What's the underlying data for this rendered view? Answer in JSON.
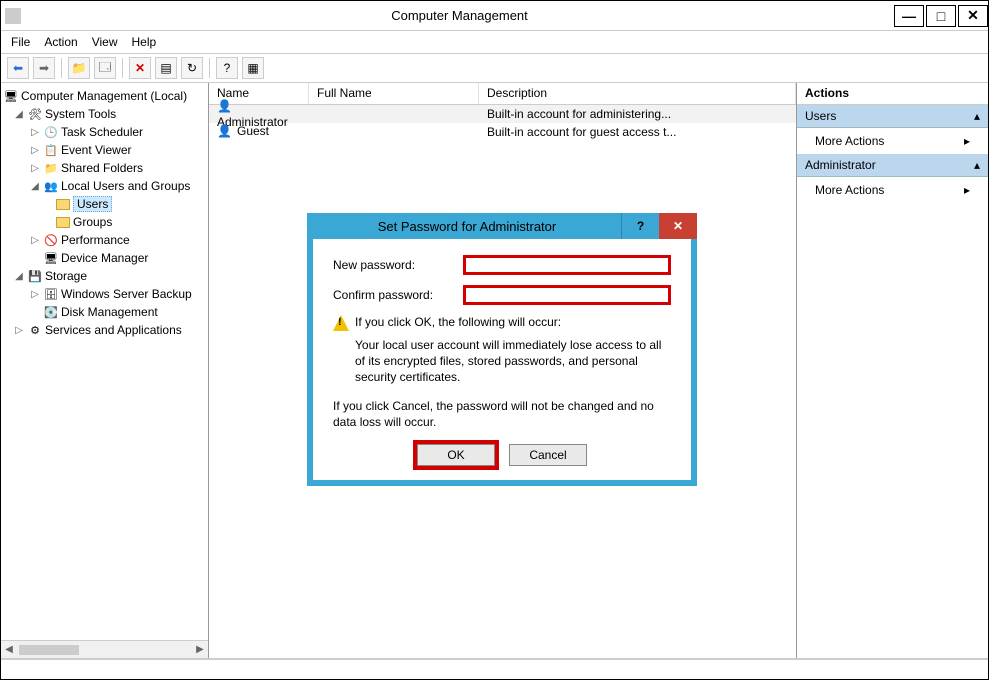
{
  "window": {
    "title": "Computer Management"
  },
  "menubar": {
    "file": "File",
    "action": "Action",
    "view": "View",
    "help": "Help"
  },
  "tree": {
    "root": "Computer Management (Local)",
    "system_tools": "System Tools",
    "task_scheduler": "Task Scheduler",
    "event_viewer": "Event Viewer",
    "shared_folders": "Shared Folders",
    "local_users": "Local Users and Groups",
    "users": "Users",
    "groups": "Groups",
    "performance": "Performance",
    "device_manager": "Device Manager",
    "storage": "Storage",
    "wsb": "Windows Server Backup",
    "disk_mgmt": "Disk Management",
    "services": "Services and Applications"
  },
  "list": {
    "headers": {
      "name": "Name",
      "full": "Full Name",
      "desc": "Description"
    },
    "rows": [
      {
        "name": "Administrator",
        "full": "",
        "desc": "Built-in account for administering..."
      },
      {
        "name": "Guest",
        "full": "",
        "desc": "Built-in account for guest access t..."
      }
    ]
  },
  "actions": {
    "title": "Actions",
    "section1": "Users",
    "more1": "More Actions",
    "section2": "Administrator",
    "more2": "More Actions"
  },
  "dialog": {
    "title": "Set Password for Administrator",
    "new_pw": "New password:",
    "confirm_pw": "Confirm password:",
    "warn_head": "If you click OK, the following will occur:",
    "warn_body": "Your local user account will immediately lose access to all of its encrypted files, stored passwords, and personal security certificates.",
    "cancel_text": "If you click Cancel, the password will not be changed and no data loss will occur.",
    "ok": "OK",
    "cancel": "Cancel"
  }
}
